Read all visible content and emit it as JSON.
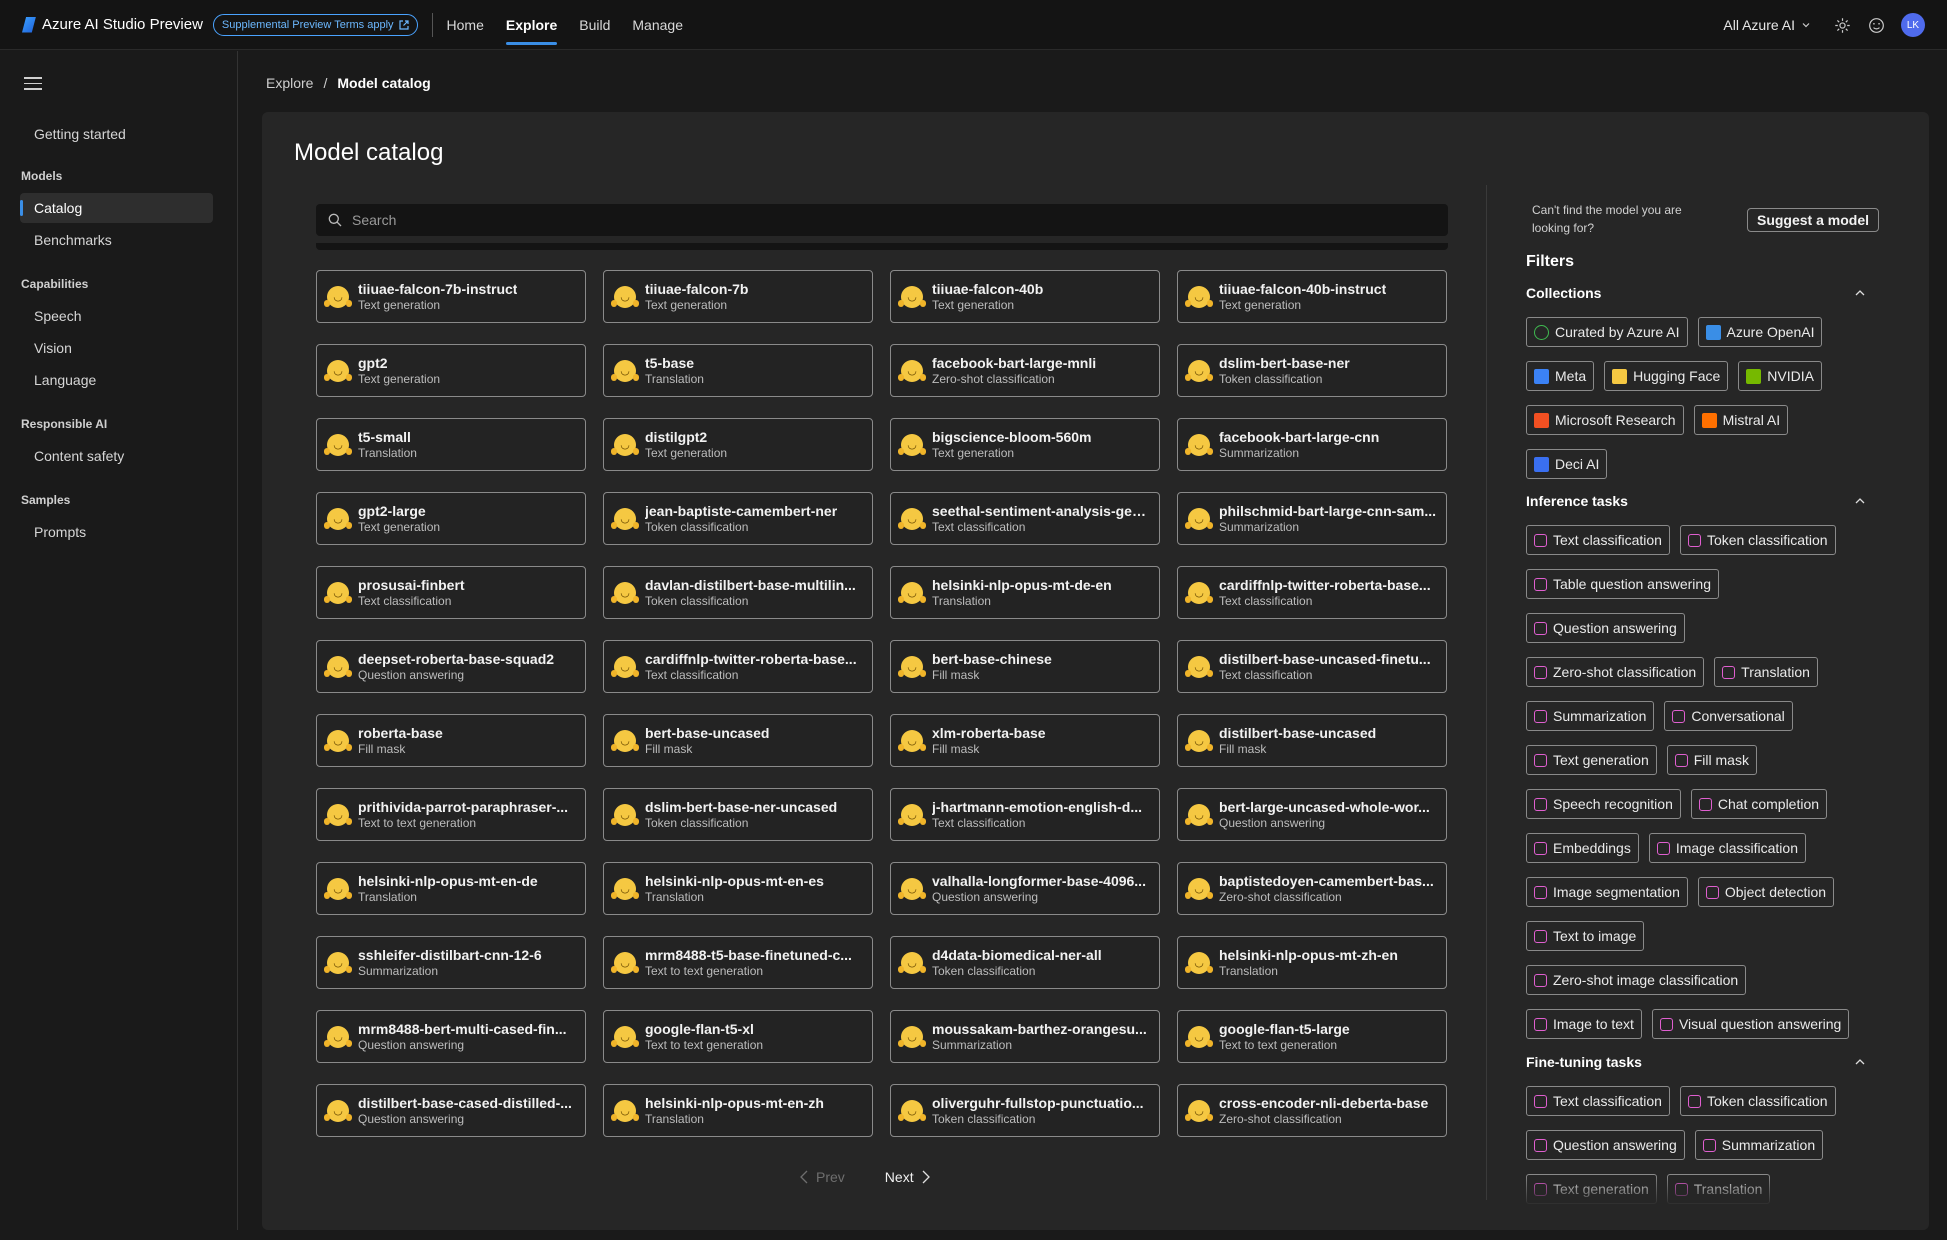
{
  "topbar": {
    "app_title": "Azure AI Studio Preview",
    "preview_pill": "Supplemental Preview Terms apply",
    "nav": [
      "Home",
      "Explore",
      "Build",
      "Manage"
    ],
    "active_nav": "Explore",
    "scope": "All Azure AI",
    "avatar_initials": "LK"
  },
  "sidebar": {
    "getting_started": "Getting started",
    "groups": {
      "models": "Models",
      "capabilities": "Capabilities",
      "responsible": "Responsible AI",
      "samples": "Samples"
    },
    "items": {
      "catalog": "Catalog",
      "benchmarks": "Benchmarks",
      "speech": "Speech",
      "vision": "Vision",
      "language": "Language",
      "content_safety": "Content safety",
      "prompts": "Prompts"
    }
  },
  "breadcrumb": {
    "root": "Explore",
    "sep": "/",
    "current": "Model catalog"
  },
  "main": {
    "title": "Model catalog",
    "search_placeholder": "Search",
    "pager": {
      "prev": "Prev",
      "next": "Next"
    }
  },
  "models": [
    {
      "name": "tiiuae-falcon-7b-instruct",
      "task": "Text generation"
    },
    {
      "name": "tiiuae-falcon-7b",
      "task": "Text generation"
    },
    {
      "name": "tiiuae-falcon-40b",
      "task": "Text generation"
    },
    {
      "name": "tiiuae-falcon-40b-instruct",
      "task": "Text generation"
    },
    {
      "name": "gpt2",
      "task": "Text generation"
    },
    {
      "name": "t5-base",
      "task": "Translation"
    },
    {
      "name": "facebook-bart-large-mnli",
      "task": "Zero-shot classification"
    },
    {
      "name": "dslim-bert-base-ner",
      "task": "Token classification"
    },
    {
      "name": "t5-small",
      "task": "Translation"
    },
    {
      "name": "distilgpt2",
      "task": "Text generation"
    },
    {
      "name": "bigscience-bloom-560m",
      "task": "Text generation"
    },
    {
      "name": "facebook-bart-large-cnn",
      "task": "Summarization"
    },
    {
      "name": "gpt2-large",
      "task": "Text generation"
    },
    {
      "name": "jean-baptiste-camembert-ner",
      "task": "Token classification"
    },
    {
      "name": "seethal-sentiment-analysis-gen...",
      "task": "Text classification"
    },
    {
      "name": "philschmid-bart-large-cnn-sam...",
      "task": "Summarization"
    },
    {
      "name": "prosusai-finbert",
      "task": "Text classification"
    },
    {
      "name": "davlan-distilbert-base-multilin...",
      "task": "Token classification"
    },
    {
      "name": "helsinki-nlp-opus-mt-de-en",
      "task": "Translation"
    },
    {
      "name": "cardiffnlp-twitter-roberta-base...",
      "task": "Text classification"
    },
    {
      "name": "deepset-roberta-base-squad2",
      "task": "Question answering"
    },
    {
      "name": "cardiffnlp-twitter-roberta-base...",
      "task": "Text classification"
    },
    {
      "name": "bert-base-chinese",
      "task": "Fill mask"
    },
    {
      "name": "distilbert-base-uncased-finetu...",
      "task": "Text classification"
    },
    {
      "name": "roberta-base",
      "task": "Fill mask"
    },
    {
      "name": "bert-base-uncased",
      "task": "Fill mask"
    },
    {
      "name": "xlm-roberta-base",
      "task": "Fill mask"
    },
    {
      "name": "distilbert-base-uncased",
      "task": "Fill mask"
    },
    {
      "name": "prithivida-parrot-paraphraser-...",
      "task": "Text to text generation"
    },
    {
      "name": "dslim-bert-base-ner-uncased",
      "task": "Token classification"
    },
    {
      "name": "j-hartmann-emotion-english-d...",
      "task": "Text classification"
    },
    {
      "name": "bert-large-uncased-whole-wor...",
      "task": "Question answering"
    },
    {
      "name": "helsinki-nlp-opus-mt-en-de",
      "task": "Translation"
    },
    {
      "name": "helsinki-nlp-opus-mt-en-es",
      "task": "Translation"
    },
    {
      "name": "valhalla-longformer-base-4096...",
      "task": "Question answering"
    },
    {
      "name": "baptistedoyen-camembert-bas...",
      "task": "Zero-shot classification"
    },
    {
      "name": "sshleifer-distilbart-cnn-12-6",
      "task": "Summarization"
    },
    {
      "name": "mrm8488-t5-base-finetuned-c...",
      "task": "Text to text generation"
    },
    {
      "name": "d4data-biomedical-ner-all",
      "task": "Token classification"
    },
    {
      "name": "helsinki-nlp-opus-mt-zh-en",
      "task": "Translation"
    },
    {
      "name": "mrm8488-bert-multi-cased-fin...",
      "task": "Question answering"
    },
    {
      "name": "google-flan-t5-xl",
      "task": "Text to text generation"
    },
    {
      "name": "moussakam-barthez-orangesu...",
      "task": "Summarization"
    },
    {
      "name": "google-flan-t5-large",
      "task": "Text to text generation"
    },
    {
      "name": "distilbert-base-cased-distilled-...",
      "task": "Question answering"
    },
    {
      "name": "helsinki-nlp-opus-mt-en-zh",
      "task": "Translation"
    },
    {
      "name": "oliverguhr-fullstop-punctuatio...",
      "task": "Token classification"
    },
    {
      "name": "cross-encoder-nli-deberta-base",
      "task": "Zero-shot classification"
    }
  ],
  "filters": {
    "cant_find": "Can't find the model you are looking for?",
    "suggest_button": "Suggest a model",
    "title": "Filters",
    "collections_title": "Collections",
    "collections": [
      {
        "label": "Curated by Azure AI",
        "icon": "check-circle-icon",
        "color": "#3fb950"
      },
      {
        "label": "Azure OpenAI",
        "icon": "azure-openai-icon",
        "color": "#3a8ee6"
      },
      {
        "label": "Meta",
        "icon": "meta-icon",
        "color": "#3b82f6"
      },
      {
        "label": "Hugging Face",
        "icon": "hugging-face-icon",
        "color": "#f5c842"
      },
      {
        "label": "NVIDIA",
        "icon": "nvidia-icon",
        "color": "#76b900"
      },
      {
        "label": "Microsoft Research",
        "icon": "microsoft-icon",
        "color": "#f25022"
      },
      {
        "label": "Mistral AI",
        "icon": "mistral-icon",
        "color": "#ff7000"
      },
      {
        "label": "Deci AI",
        "icon": "deci-icon",
        "color": "#3a6ff0"
      }
    ],
    "inference_title": "Inference tasks",
    "inference": [
      "Text classification",
      "Token classification",
      "Table question answering",
      "Question answering",
      "Zero-shot classification",
      "Translation",
      "Summarization",
      "Conversational",
      "Text generation",
      "Fill mask",
      "Speech recognition",
      "Chat completion",
      "Embeddings",
      "Image classification",
      "Image segmentation",
      "Object detection",
      "Text to image",
      "Zero-shot image classification",
      "Image to text",
      "Visual question answering"
    ],
    "finetuning_title": "Fine-tuning tasks",
    "finetuning": [
      "Text classification",
      "Token classification",
      "Question answering",
      "Summarization",
      "Text generation",
      "Translation"
    ],
    "task_icon_color": "#e05fd0"
  }
}
